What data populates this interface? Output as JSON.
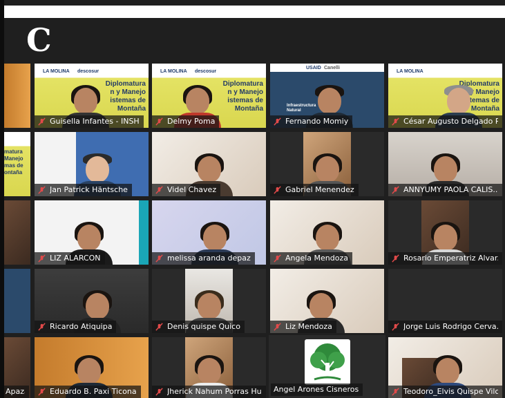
{
  "header": {
    "letter": "C"
  },
  "colors": {
    "speaking_border": "#b7dc5d",
    "muted_mic": "#e24a4a"
  },
  "slide": {
    "logo_left": "LA MOLINA",
    "logo_mid": "descosur",
    "title_line1": "Diplomatura",
    "title_line2": "n y Manejo",
    "title_line3": "istemas de",
    "title_line4": "Montaña",
    "usaid": "USAID",
    "canelli": "Canelli",
    "infra_title": "Infraestructura Natural",
    "left_partial1": "matura",
    "left_partial2": "Manejo",
    "left_partial3": "mas de",
    "left_partial4": "ontaña"
  },
  "participants": [
    {
      "name": ""
    },
    {
      "name": "Guisella Infantes - INSH"
    },
    {
      "name": "Delmy Poma"
    },
    {
      "name": "Fernando Momiy"
    },
    {
      "name": "César Augusto Delgado Piza..."
    },
    {
      "name": ""
    },
    {
      "name": "Jan Patrick Häntsche"
    },
    {
      "name": "Videl Chavez"
    },
    {
      "name": "Gabriel Menendez"
    },
    {
      "name": "ANNYUMY PAOLA CALIS..."
    },
    {
      "name": ""
    },
    {
      "name": "LIZ ALARCON"
    },
    {
      "name": "melissa aranda depaz"
    },
    {
      "name": "Angela Mendoza"
    },
    {
      "name": "Rosario Emperatriz Alvar..."
    },
    {
      "name": ""
    },
    {
      "name": "Ricardo Atiquipa"
    },
    {
      "name": "Denis quispe Quico"
    },
    {
      "name": "Liz Mendoza"
    },
    {
      "name": "Jorge Luis Rodrigo Cerva..."
    },
    {
      "name": "Apaza"
    },
    {
      "name": "Eduardo B. Paxi Ticona"
    },
    {
      "name": "Jherick Nahum Porras Hu..."
    },
    {
      "name": "Angel Arones Cisneros"
    },
    {
      "name": "Teodoro_Elvis Quispe Vilca"
    }
  ]
}
